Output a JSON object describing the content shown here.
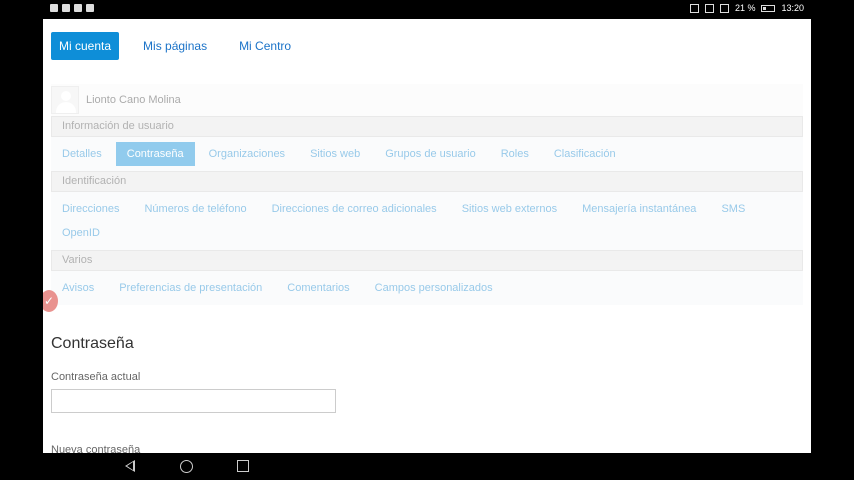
{
  "statusbar": {
    "battery_text": "21 %",
    "time": "13:20"
  },
  "topnav": {
    "items": [
      {
        "label": "Mi cuenta",
        "active": true
      },
      {
        "label": "Mis páginas",
        "active": false
      },
      {
        "label": "Mi Centro",
        "active": false
      }
    ]
  },
  "user": {
    "name": "Lionto Cano Molina"
  },
  "sections": [
    {
      "header": "Información de usuario",
      "tabs": [
        "Detalles",
        "Contraseña",
        "Organizaciones",
        "Sitios web",
        "Grupos de usuario",
        "Roles",
        "Clasificación"
      ],
      "active": "Contraseña"
    },
    {
      "header": "Identificación",
      "tabs": [
        "Direcciones",
        "Números de teléfono",
        "Direcciones de correo adicionales",
        "Sitios web externos",
        "Mensajería instantánea",
        "SMS",
        "OpenID"
      ]
    },
    {
      "header": "Varios",
      "tabs": [
        "Avisos",
        "Preferencias de presentación",
        "Comentarios",
        "Campos personalizados"
      ]
    }
  ],
  "form": {
    "title": "Contraseña",
    "current_label": "Contraseña actual",
    "current_value": "",
    "new_label": "Nueva contraseña"
  },
  "colors": {
    "accent": "#0e8ed8",
    "link": "#1b8ad0",
    "marker": "#e9928f"
  }
}
